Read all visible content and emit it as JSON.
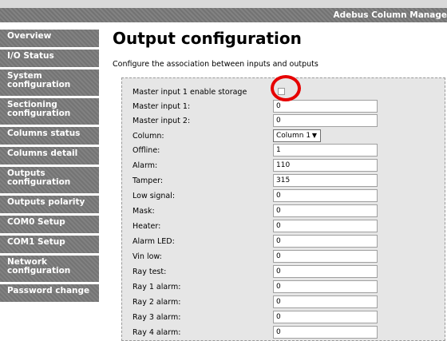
{
  "app": {
    "title": "Adebus Column Manage"
  },
  "sidebar": {
    "items": [
      {
        "label": "Overview"
      },
      {
        "label": "I/O Status"
      },
      {
        "label": "System configuration"
      },
      {
        "label": "Sectioning configuration"
      },
      {
        "label": "Columns status"
      },
      {
        "label": "Columns detail"
      },
      {
        "label": "Outputs configuration"
      },
      {
        "label": "Outputs polarity"
      },
      {
        "label": "COM0 Setup"
      },
      {
        "label": "COM1 Setup"
      },
      {
        "label": "Network configuration"
      },
      {
        "label": "Password change"
      }
    ]
  },
  "main": {
    "title": "Output configuration",
    "description": "Configure the association between inputs and outputs"
  },
  "form": {
    "rows": [
      {
        "label": "Master input 1 enable storage",
        "type": "checkbox",
        "checked": false
      },
      {
        "label": "Master input 1:",
        "type": "text",
        "value": "0"
      },
      {
        "label": "Master input 2:",
        "type": "text",
        "value": "0"
      },
      {
        "label": "Column:",
        "type": "select",
        "value": "Column 1"
      },
      {
        "label": "Offline:",
        "type": "text",
        "value": "1"
      },
      {
        "label": "Alarm:",
        "type": "text",
        "value": "110"
      },
      {
        "label": "Tamper:",
        "type": "text",
        "value": "315"
      },
      {
        "label": "Low signal:",
        "type": "text",
        "value": "0"
      },
      {
        "label": "Mask:",
        "type": "text",
        "value": "0"
      },
      {
        "label": "Heater:",
        "type": "text",
        "value": "0"
      },
      {
        "label": "Alarm LED:",
        "type": "text",
        "value": "0"
      },
      {
        "label": "Vin low:",
        "type": "text",
        "value": "0"
      },
      {
        "label": "Ray test:",
        "type": "text",
        "value": "0"
      },
      {
        "label": "Ray 1 alarm:",
        "type": "text",
        "value": "0"
      },
      {
        "label": "Ray 2 alarm:",
        "type": "text",
        "value": "0"
      },
      {
        "label": "Ray 3 alarm:",
        "type": "text",
        "value": "0"
      },
      {
        "label": "Ray 4 alarm:",
        "type": "text",
        "value": "0"
      }
    ]
  },
  "colors": {
    "sidebar": "#7a7a7a",
    "panel": "#e6e6e6",
    "highlight": "#e60000"
  }
}
